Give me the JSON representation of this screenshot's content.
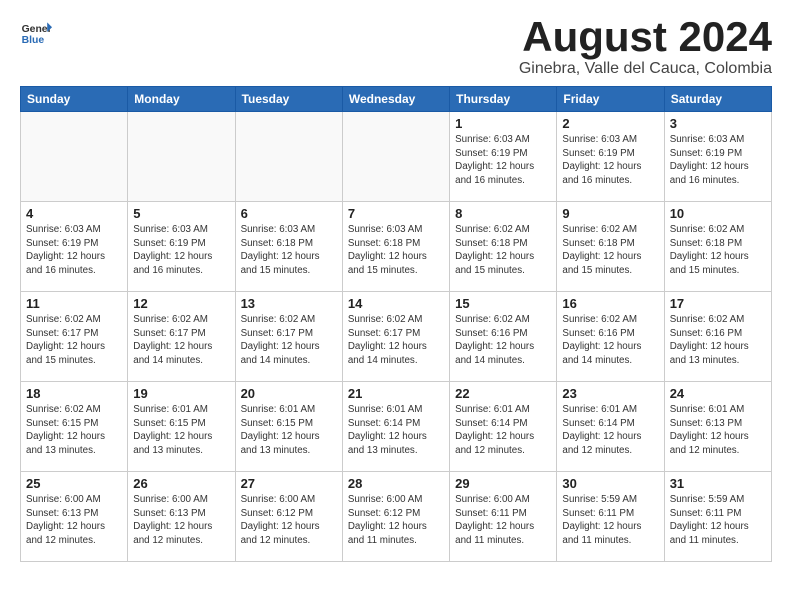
{
  "logo": {
    "general": "General",
    "blue": "Blue"
  },
  "header": {
    "title": "August 2024",
    "subtitle": "Ginebra, Valle del Cauca, Colombia"
  },
  "weekdays": [
    "Sunday",
    "Monday",
    "Tuesday",
    "Wednesday",
    "Thursday",
    "Friday",
    "Saturday"
  ],
  "weeks": [
    [
      {
        "day": "",
        "info": ""
      },
      {
        "day": "",
        "info": ""
      },
      {
        "day": "",
        "info": ""
      },
      {
        "day": "",
        "info": ""
      },
      {
        "day": "1",
        "info": "Sunrise: 6:03 AM\nSunset: 6:19 PM\nDaylight: 12 hours\nand 16 minutes."
      },
      {
        "day": "2",
        "info": "Sunrise: 6:03 AM\nSunset: 6:19 PM\nDaylight: 12 hours\nand 16 minutes."
      },
      {
        "day": "3",
        "info": "Sunrise: 6:03 AM\nSunset: 6:19 PM\nDaylight: 12 hours\nand 16 minutes."
      }
    ],
    [
      {
        "day": "4",
        "info": "Sunrise: 6:03 AM\nSunset: 6:19 PM\nDaylight: 12 hours\nand 16 minutes."
      },
      {
        "day": "5",
        "info": "Sunrise: 6:03 AM\nSunset: 6:19 PM\nDaylight: 12 hours\nand 16 minutes."
      },
      {
        "day": "6",
        "info": "Sunrise: 6:03 AM\nSunset: 6:18 PM\nDaylight: 12 hours\nand 15 minutes."
      },
      {
        "day": "7",
        "info": "Sunrise: 6:03 AM\nSunset: 6:18 PM\nDaylight: 12 hours\nand 15 minutes."
      },
      {
        "day": "8",
        "info": "Sunrise: 6:02 AM\nSunset: 6:18 PM\nDaylight: 12 hours\nand 15 minutes."
      },
      {
        "day": "9",
        "info": "Sunrise: 6:02 AM\nSunset: 6:18 PM\nDaylight: 12 hours\nand 15 minutes."
      },
      {
        "day": "10",
        "info": "Sunrise: 6:02 AM\nSunset: 6:18 PM\nDaylight: 12 hours\nand 15 minutes."
      }
    ],
    [
      {
        "day": "11",
        "info": "Sunrise: 6:02 AM\nSunset: 6:17 PM\nDaylight: 12 hours\nand 15 minutes."
      },
      {
        "day": "12",
        "info": "Sunrise: 6:02 AM\nSunset: 6:17 PM\nDaylight: 12 hours\nand 14 minutes."
      },
      {
        "day": "13",
        "info": "Sunrise: 6:02 AM\nSunset: 6:17 PM\nDaylight: 12 hours\nand 14 minutes."
      },
      {
        "day": "14",
        "info": "Sunrise: 6:02 AM\nSunset: 6:17 PM\nDaylight: 12 hours\nand 14 minutes."
      },
      {
        "day": "15",
        "info": "Sunrise: 6:02 AM\nSunset: 6:16 PM\nDaylight: 12 hours\nand 14 minutes."
      },
      {
        "day": "16",
        "info": "Sunrise: 6:02 AM\nSunset: 6:16 PM\nDaylight: 12 hours\nand 14 minutes."
      },
      {
        "day": "17",
        "info": "Sunrise: 6:02 AM\nSunset: 6:16 PM\nDaylight: 12 hours\nand 13 minutes."
      }
    ],
    [
      {
        "day": "18",
        "info": "Sunrise: 6:02 AM\nSunset: 6:15 PM\nDaylight: 12 hours\nand 13 minutes."
      },
      {
        "day": "19",
        "info": "Sunrise: 6:01 AM\nSunset: 6:15 PM\nDaylight: 12 hours\nand 13 minutes."
      },
      {
        "day": "20",
        "info": "Sunrise: 6:01 AM\nSunset: 6:15 PM\nDaylight: 12 hours\nand 13 minutes."
      },
      {
        "day": "21",
        "info": "Sunrise: 6:01 AM\nSunset: 6:14 PM\nDaylight: 12 hours\nand 13 minutes."
      },
      {
        "day": "22",
        "info": "Sunrise: 6:01 AM\nSunset: 6:14 PM\nDaylight: 12 hours\nand 12 minutes."
      },
      {
        "day": "23",
        "info": "Sunrise: 6:01 AM\nSunset: 6:14 PM\nDaylight: 12 hours\nand 12 minutes."
      },
      {
        "day": "24",
        "info": "Sunrise: 6:01 AM\nSunset: 6:13 PM\nDaylight: 12 hours\nand 12 minutes."
      }
    ],
    [
      {
        "day": "25",
        "info": "Sunrise: 6:00 AM\nSunset: 6:13 PM\nDaylight: 12 hours\nand 12 minutes."
      },
      {
        "day": "26",
        "info": "Sunrise: 6:00 AM\nSunset: 6:13 PM\nDaylight: 12 hours\nand 12 minutes."
      },
      {
        "day": "27",
        "info": "Sunrise: 6:00 AM\nSunset: 6:12 PM\nDaylight: 12 hours\nand 12 minutes."
      },
      {
        "day": "28",
        "info": "Sunrise: 6:00 AM\nSunset: 6:12 PM\nDaylight: 12 hours\nand 11 minutes."
      },
      {
        "day": "29",
        "info": "Sunrise: 6:00 AM\nSunset: 6:11 PM\nDaylight: 12 hours\nand 11 minutes."
      },
      {
        "day": "30",
        "info": "Sunrise: 5:59 AM\nSunset: 6:11 PM\nDaylight: 12 hours\nand 11 minutes."
      },
      {
        "day": "31",
        "info": "Sunrise: 5:59 AM\nSunset: 6:11 PM\nDaylight: 12 hours\nand 11 minutes."
      }
    ]
  ]
}
